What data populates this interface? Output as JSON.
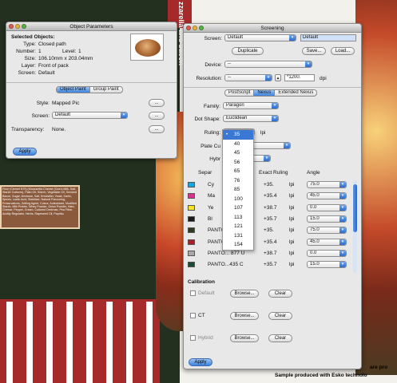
{
  "background": {
    "side_text": "zzarella and bacon",
    "pack_text": "Flour (Ciemet N79) (Mozzarella Cheese (Cow's Milk, Salt, Starter Cultures), Palm Oil, Starch, Vegetable Oil, Smoked Bacon, Sugar, Dextrose, Salt, Emulsifier, Yeast, Garlic, Spices, Lactic Acid, Stabiliser, Natural Flavouring, Preservatives, Gelling Agent, Colour, Antioxidant, Modified Starch, Milk Protein, Whey Powder, Onion Powder, Ham, Cheese, Pepper, Cream, Cultured Dextrose, Pea Fibre, Acidity Regulator, Herbs, Rapeseed Oil, Paprika.",
    "caption_1": "are pro",
    "caption_2": "Sample produced with Esko technolo"
  },
  "object_params": {
    "title": "Object Parameters",
    "heading": "Selected Objects:",
    "type_label": "Type:",
    "type_value": "Closed path",
    "number_label": "Number:",
    "number_value": "1",
    "level_label": "Level:",
    "level_value": "1",
    "size_label": "Size:",
    "size_value": "106.10mm x 203.04mm",
    "layer_label": "Layer:",
    "layer_value": "Front of pack",
    "screen_label": "Screen:",
    "screen_value": "Default",
    "tabs": [
      "Object Paint",
      "Group Paint"
    ],
    "style_label": "Style:",
    "style_value": "Mapped Pic",
    "screen2_label": "Screen:",
    "screen2_value": "Default",
    "transparency_label": "Transparency:",
    "transparency_value": "None.",
    "more_btn": "...",
    "apply_btn": "Apply"
  },
  "screening": {
    "title": "Screening",
    "screen_label": "Screen:",
    "screen_value": "Default",
    "screen_name": "Default",
    "duplicate_btn": "Duplicate",
    "save_btn": "Save...",
    "load_btn": "Load...",
    "device_label": "Device:",
    "device_value": "--",
    "resolution_label": "Resolution:",
    "resolution_value": "--",
    "resolution_num": "*1200.",
    "resolution_unit": "dpi",
    "tabs": [
      "PostScript",
      "Nexus",
      "Extended Nexus"
    ],
    "family_label": "Family:",
    "family_value": "Paragon",
    "dot_label": "Dot Shape:",
    "dot_value": "Euclidean",
    "ruling_label": "Ruling:",
    "ruling_unit": "lpi",
    "plate_label": "Plate Cu",
    "hybrid_label": "Hybr",
    "col_sep": "Separ",
    "col_ruling": "Exact Ruling",
    "col_angle": "Angle",
    "ruling_options": [
      "35",
      "40",
      "45",
      "56",
      "65",
      "76",
      "85",
      "100",
      "107",
      "113",
      "121",
      "131",
      "154"
    ],
    "ruling_selected": "35",
    "rows": [
      {
        "name": "Cy",
        "color": "#1ea3dc",
        "ruling": "+35.",
        "unit": "lpi",
        "angle": "75.0"
      },
      {
        "name": "Ma",
        "color": "#d6338a",
        "ruling": "+35.4",
        "unit": "lpi",
        "angle": "45.0"
      },
      {
        "name": "Ye",
        "color": "#f3e32a",
        "ruling": "+38.7",
        "unit": "lpi",
        "angle": "0.0"
      },
      {
        "name": "Bl",
        "color": "#1a1a1a",
        "ruling": "+35.7",
        "unit": "lpi",
        "angle": "15.0"
      },
      {
        "name": "PANTONE",
        "color": "#2c3b22",
        "ruling": "+35.",
        "unit": "lpi",
        "angle": "75.0"
      },
      {
        "name": "PANTONE 187 C",
        "color": "#a3222a",
        "ruling": "+35.4",
        "unit": "lpi",
        "angle": "45.0"
      },
      {
        "name": "PANTO... 877 U",
        "color": "#a9a9a9",
        "ruling": "+38.7",
        "unit": "lpi",
        "angle": "0.0"
      },
      {
        "name": "PANTO...435 C",
        "color": "#1e4a33",
        "ruling": "+35.7",
        "unit": "lpi",
        "angle": "15.0"
      }
    ],
    "calibration_label": "Calibration",
    "cal_rows": [
      {
        "label": "Default",
        "browse": "Browse...",
        "clear": "Clear"
      },
      {
        "label": "CT",
        "browse": "Browse...",
        "clear": "Clear"
      },
      {
        "label": "Hybrid",
        "browse": "Browse...",
        "clear": "Clear"
      }
    ],
    "apply_btn": "Apply"
  }
}
